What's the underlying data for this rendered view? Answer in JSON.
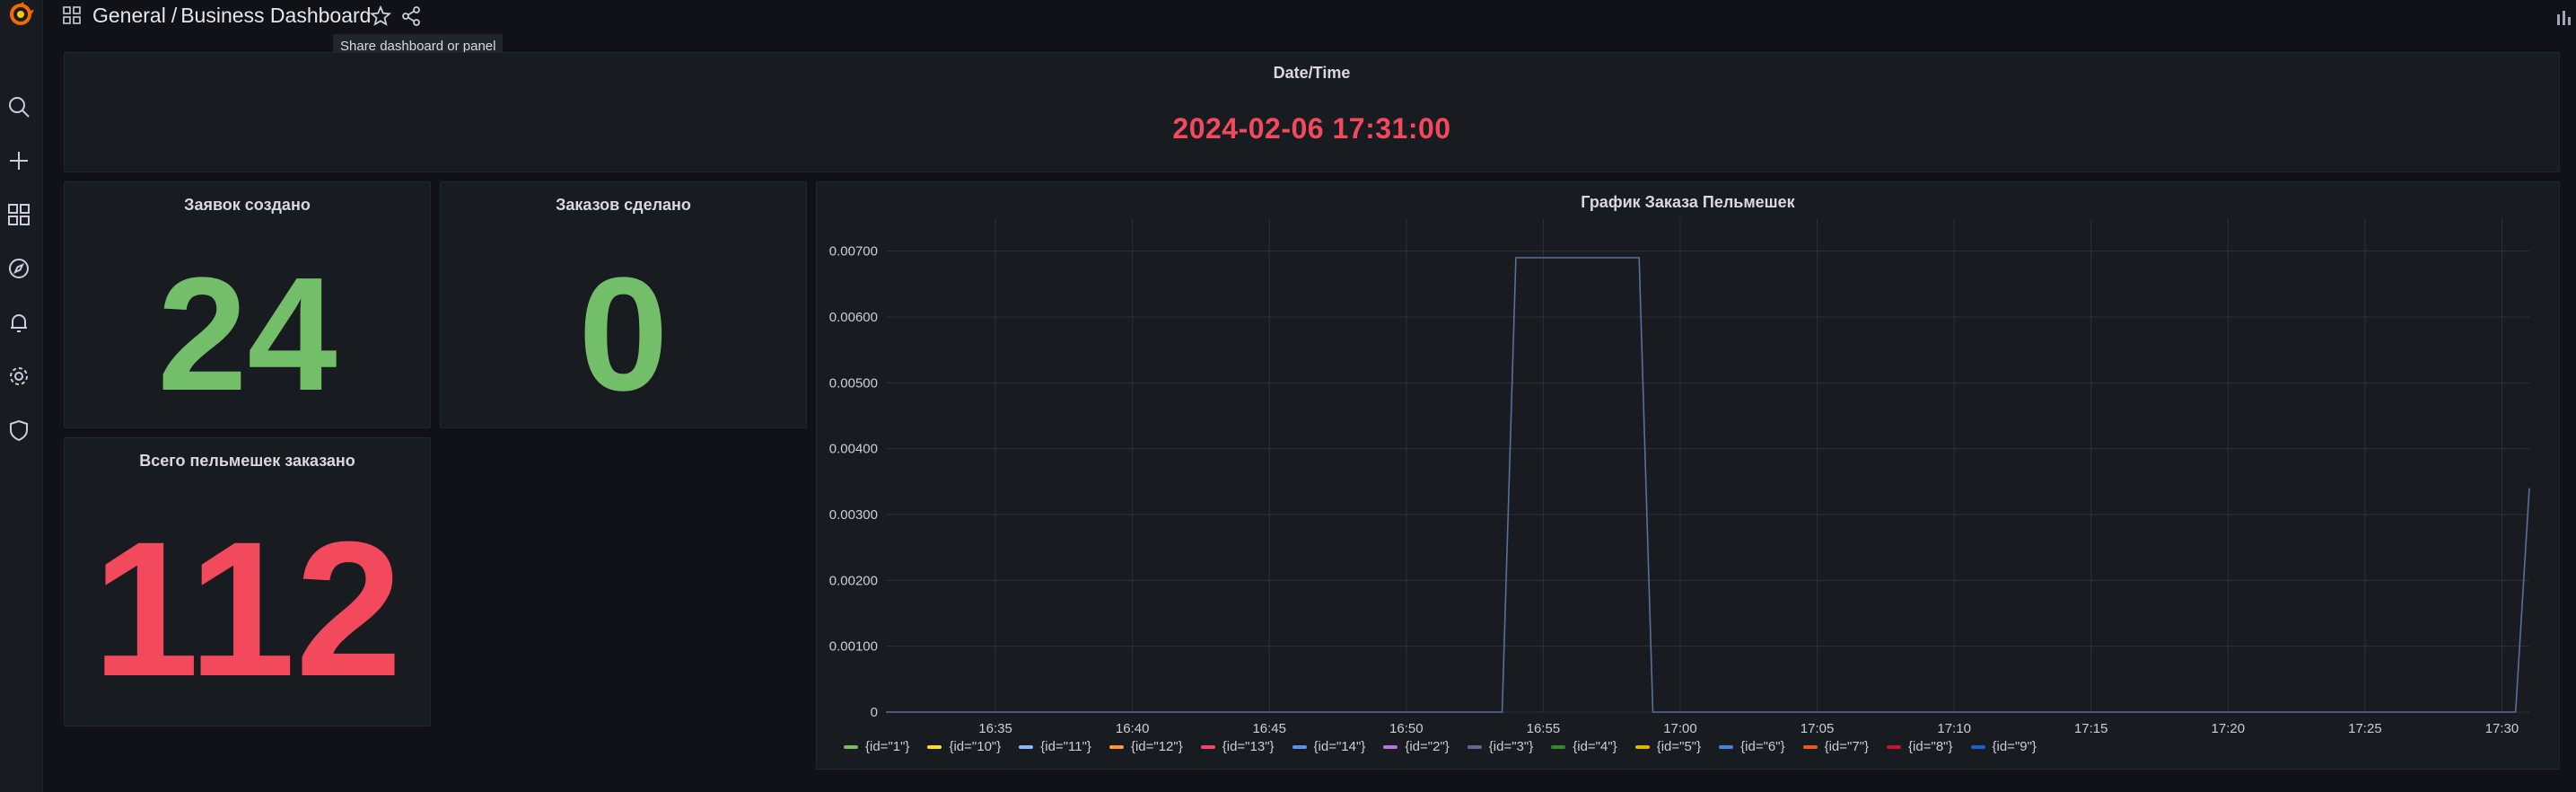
{
  "topbar": {
    "folder": "General",
    "separator": "/",
    "dashboard_title": "Business Dashboard",
    "tooltip": "Share dashboard or panel"
  },
  "panels": {
    "datetime": {
      "title": "Date/Time",
      "value": "2024-02-06 17:31:00",
      "color": "#f2495c"
    },
    "created": {
      "title": "Заявок создано",
      "value": "24",
      "color": "#73bf69"
    },
    "orders": {
      "title": "Заказов сделано",
      "value": "0",
      "color": "#73bf69"
    },
    "total": {
      "title": "Всего пельмешек заказано",
      "value": "112",
      "color": "#f2495c"
    }
  },
  "colors": {
    "background": "#111217",
    "panel": "#181b1f",
    "green": "#73bf69",
    "red": "#f2495c"
  },
  "sidemenu": [
    "search-icon",
    "plus-icon",
    "dashboards-icon",
    "explore-icon",
    "alert-bell-icon",
    "gear-icon",
    "shield-icon"
  ],
  "chart_data": {
    "type": "line",
    "title": "График Заказа Пельмешек",
    "xlabel": "",
    "ylabel": "",
    "xlim": [
      "16:31",
      "17:31"
    ],
    "ylim": [
      0,
      0.0075
    ],
    "x_ticks": [
      "16:35",
      "16:40",
      "16:45",
      "16:50",
      "16:55",
      "17:00",
      "17:05",
      "17:10",
      "17:15",
      "17:20",
      "17:25",
      "17:30"
    ],
    "y_ticks": [
      "0",
      "0.00100",
      "0.00200",
      "0.00300",
      "0.00400",
      "0.00500",
      "0.00600",
      "0.00700"
    ],
    "grid": true,
    "legend_position": "bottom-left",
    "series": [
      {
        "name": "{id=\"1\"}",
        "color": "#73bf69",
        "points": []
      },
      {
        "name": "{id=\"10\"}",
        "color": "#fade2a",
        "points": []
      },
      {
        "name": "{id=\"11\"}",
        "color": "#8ab8ff",
        "points": []
      },
      {
        "name": "{id=\"12\"}",
        "color": "#ff9830",
        "points": []
      },
      {
        "name": "{id=\"13\"}",
        "color": "#f2495c",
        "points": []
      },
      {
        "name": "{id=\"14\"}",
        "color": "#5794f2",
        "points": []
      },
      {
        "name": "{id=\"2\"}",
        "color": "#b877d9",
        "points": []
      },
      {
        "name": "{id=\"3\"}",
        "color": "#705da0",
        "points": []
      },
      {
        "name": "{id=\"4\"}",
        "color": "#37872d",
        "points": []
      },
      {
        "name": "{id=\"5\"}",
        "color": "#e0b400",
        "points": []
      },
      {
        "name": "{id=\"6\"}",
        "color": "#4983d6",
        "points": []
      },
      {
        "name": "{id=\"7\"}",
        "color": "#e55b19",
        "points": []
      },
      {
        "name": "{id=\"8\"}",
        "color": "#c4162a",
        "points": []
      },
      {
        "name": "{id=\"9\"}",
        "color": "#1f60c4",
        "points": [
          [
            "16:31",
            0
          ],
          [
            "16:53:30",
            0
          ],
          [
            "16:54",
            0.0069
          ],
          [
            "16:58:30",
            0.0069
          ],
          [
            "16:59",
            0
          ],
          [
            "17:30:30",
            0
          ],
          [
            "17:31",
            0.0034
          ]
        ]
      }
    ]
  }
}
